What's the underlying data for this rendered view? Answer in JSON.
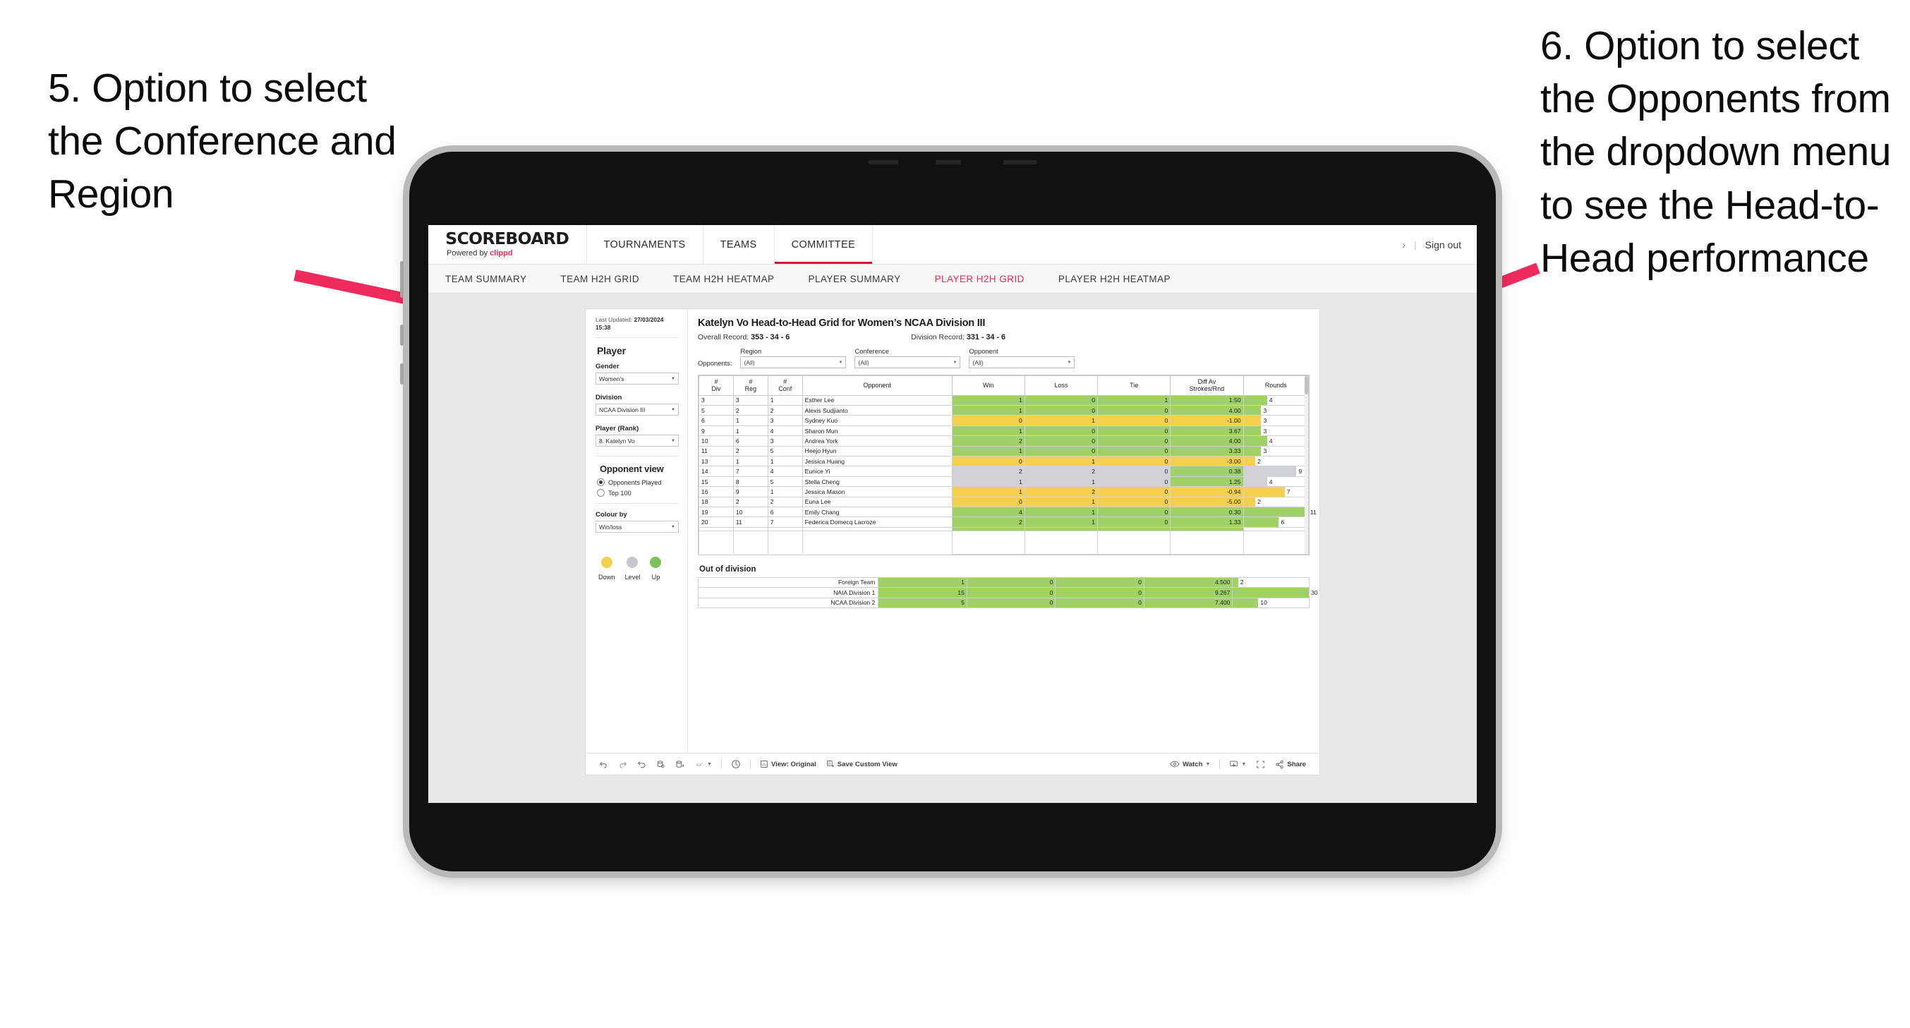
{
  "annotations": {
    "left": "5. Option to select the Conference and Region",
    "right": "6. Option to select the Opponents from the dropdown menu to see the Head-to-Head performance",
    "arrow_color": "#ef2b5e"
  },
  "app": {
    "brand": {
      "title": "SCOREBOARD",
      "powered_prefix": "Powered by ",
      "powered_brand": "clippd"
    },
    "top_nav": [
      {
        "label": "TOURNAMENTS",
        "active": false
      },
      {
        "label": "TEAMS",
        "active": false
      },
      {
        "label": "COMMITTEE",
        "active": true
      }
    ],
    "header_right": {
      "chevron": "›",
      "separator": "|",
      "sign_out": "Sign out"
    },
    "sub_tabs": [
      {
        "label": "TEAM SUMMARY",
        "active": false
      },
      {
        "label": "TEAM H2H GRID",
        "active": false
      },
      {
        "label": "TEAM H2H HEATMAP",
        "active": false
      },
      {
        "label": "PLAYER SUMMARY",
        "active": false
      },
      {
        "label": "PLAYER H2H GRID",
        "active": true
      },
      {
        "label": "PLAYER H2H HEATMAP",
        "active": false
      }
    ]
  },
  "sidebar": {
    "last_updated_label": "Last Updated: ",
    "last_updated_value": "27/03/2024",
    "last_updated_time": "15:38",
    "player_heading": "Player",
    "fields": [
      {
        "label": "Gender",
        "value": "Women’s"
      },
      {
        "label": "Division",
        "value": "NCAA Division III"
      },
      {
        "label": "Player (Rank)",
        "value": "8. Katelyn Vo"
      }
    ],
    "opponent_view": {
      "heading": "Opponent view",
      "options": [
        {
          "label": "Opponents Played",
          "selected": true
        },
        {
          "label": "Top 100",
          "selected": false
        }
      ]
    },
    "colour_by": {
      "label": "Colour by",
      "value": "Win/loss"
    },
    "legend": [
      {
        "label": "Down",
        "color": "#f5d04e"
      },
      {
        "label": "Level",
        "color": "#c5c8cc"
      },
      {
        "label": "Up",
        "color": "#7fc25b"
      }
    ]
  },
  "main": {
    "title": "Katelyn Vo Head-to-Head Grid for Women’s NCAA Division III",
    "overall_record_label": "Overall Record: ",
    "overall_record_value": "353 - 34 - 6",
    "division_record_label": "Division Record: ",
    "division_record_value": "331 -  34 - 6",
    "opponents_label": "Opponents:",
    "filters": [
      {
        "label": "Region",
        "value": "(All)"
      },
      {
        "label": "Conference",
        "value": "(All)"
      },
      {
        "label": "Opponent",
        "value": "(All)"
      }
    ],
    "grid_headers": {
      "div": "#\nDiv",
      "div_l1": "#",
      "div_l2": "Div",
      "reg_l1": "#",
      "reg_l2": "Reg",
      "conf_l1": "#",
      "conf_l2": "Conf",
      "opponent": "Opponent",
      "win": "Win",
      "loss": "Loss",
      "tie": "Tie",
      "diff_l1": "Diff Av",
      "diff_l2": "Strokes/Rnd",
      "rounds": "Rounds"
    },
    "out_of_division_heading": "Out of division"
  },
  "chart_data": {
    "type": "table",
    "title": "Katelyn Vo Head-to-Head Grid for Women’s NCAA Division III",
    "columns": [
      "# Div",
      "# Reg",
      "# Conf",
      "Opponent",
      "Win",
      "Loss",
      "Tie",
      "Diff Av Strokes/Rnd",
      "Rounds"
    ],
    "rounds_max": 11,
    "rows": [
      {
        "div": "3",
        "reg": "3",
        "conf": "1",
        "opponent": "Esther Lee",
        "win": "1",
        "loss": "0",
        "tie": "1",
        "diff": "1.50",
        "rounds": "4",
        "color": "g"
      },
      {
        "div": "5",
        "reg": "2",
        "conf": "2",
        "opponent": "Alexis Sudjianto",
        "win": "1",
        "loss": "0",
        "tie": "0",
        "diff": "4.00",
        "rounds": "3",
        "color": "g"
      },
      {
        "div": "6",
        "reg": "1",
        "conf": "3",
        "opponent": "Sydney Kuo",
        "win": "0",
        "loss": "1",
        "tie": "0",
        "diff": "-1.00",
        "rounds": "3",
        "color": "y"
      },
      {
        "div": "9",
        "reg": "1",
        "conf": "4",
        "opponent": "Sharon Mun",
        "win": "1",
        "loss": "0",
        "tie": "0",
        "diff": "3.67",
        "rounds": "3",
        "color": "g"
      },
      {
        "div": "10",
        "reg": "6",
        "conf": "3",
        "opponent": "Andrea York",
        "win": "2",
        "loss": "0",
        "tie": "0",
        "diff": "4.00",
        "rounds": "4",
        "color": "g"
      },
      {
        "div": "11",
        "reg": "2",
        "conf": "5",
        "opponent": "Heejo Hyun",
        "win": "1",
        "loss": "0",
        "tie": "0",
        "diff": "3.33",
        "rounds": "3",
        "color": "g"
      },
      {
        "div": "13",
        "reg": "1",
        "conf": "1",
        "opponent": "Jessica Huang",
        "win": "0",
        "loss": "1",
        "tie": "0",
        "diff": "-3.00",
        "rounds": "2",
        "color": "y"
      },
      {
        "div": "14",
        "reg": "7",
        "conf": "4",
        "opponent": "Eunice Yi",
        "win": "2",
        "loss": "2",
        "tie": "0",
        "diff": "0.38",
        "rounds": "9",
        "color": "gr",
        "diff_color": "g"
      },
      {
        "div": "15",
        "reg": "8",
        "conf": "5",
        "opponent": "Stella Cheng",
        "win": "1",
        "loss": "1",
        "tie": "0",
        "diff": "1.25",
        "rounds": "4",
        "color": "gr",
        "diff_color": "g"
      },
      {
        "div": "16",
        "reg": "9",
        "conf": "1",
        "opponent": "Jessica Mason",
        "win": "1",
        "loss": "2",
        "tie": "0",
        "diff": "-0.94",
        "rounds": "7",
        "color": "y"
      },
      {
        "div": "18",
        "reg": "2",
        "conf": "2",
        "opponent": "Euna Lee",
        "win": "0",
        "loss": "1",
        "tie": "0",
        "diff": "-5.00",
        "rounds": "2",
        "color": "y"
      },
      {
        "div": "19",
        "reg": "10",
        "conf": "6",
        "opponent": "Emily Chang",
        "win": "4",
        "loss": "1",
        "tie": "0",
        "diff": "0.30",
        "rounds": "11",
        "color": "g"
      },
      {
        "div": "20",
        "reg": "11",
        "conf": "7",
        "opponent": "Federica Domecq Lacroze",
        "win": "2",
        "loss": "1",
        "tie": "0",
        "diff": "1.33",
        "rounds": "6",
        "color": "g"
      }
    ],
    "out_of_division": {
      "rounds_max": 30,
      "rows": [
        {
          "name": "Foreign Team",
          "win": "1",
          "loss": "0",
          "tie": "0",
          "diff": "4.500",
          "rounds": "2",
          "color": "g"
        },
        {
          "name": "NAIA Division 1",
          "win": "15",
          "loss": "0",
          "tie": "0",
          "diff": "9.267",
          "rounds": "30",
          "color": "g"
        },
        {
          "name": "NCAA Division 2",
          "win": "5",
          "loss": "0",
          "tie": "0",
          "diff": "7.400",
          "rounds": "10",
          "color": "g"
        }
      ]
    }
  },
  "toolbar": {
    "left_icons": [
      "undo-icon",
      "redo-icon",
      "revert-icon",
      "refresh-data-icon",
      "pause-updates-icon",
      "loop-icon"
    ],
    "view_label": "View: Original",
    "save_custom_view_label": "Save Custom View",
    "watch_label": "Watch",
    "share_label": "Share"
  }
}
